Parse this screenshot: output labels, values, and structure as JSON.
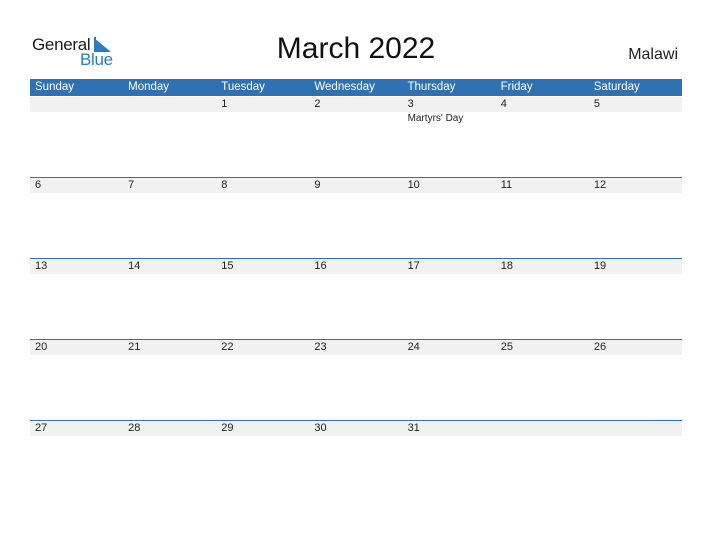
{
  "logo": {
    "line1": "General",
    "line2": "Blue",
    "accent": "#2a7bc4"
  },
  "title": "March 2022",
  "country": "Malawi",
  "colors": {
    "header_bg": "#2e72b3",
    "date_strip": "#f1f1f1"
  },
  "weekdays": [
    "Sunday",
    "Monday",
    "Tuesday",
    "Wednesday",
    "Thursday",
    "Friday",
    "Saturday"
  ],
  "weeks": [
    [
      {
        "day": ""
      },
      {
        "day": ""
      },
      {
        "day": "1"
      },
      {
        "day": "2"
      },
      {
        "day": "3",
        "holiday": "Martyrs' Day"
      },
      {
        "day": "4"
      },
      {
        "day": "5"
      }
    ],
    [
      {
        "day": "6"
      },
      {
        "day": "7"
      },
      {
        "day": "8"
      },
      {
        "day": "9"
      },
      {
        "day": "10"
      },
      {
        "day": "11"
      },
      {
        "day": "12"
      }
    ],
    [
      {
        "day": "13"
      },
      {
        "day": "14"
      },
      {
        "day": "15"
      },
      {
        "day": "16"
      },
      {
        "day": "17"
      },
      {
        "day": "18"
      },
      {
        "day": "19"
      }
    ],
    [
      {
        "day": "20"
      },
      {
        "day": "21"
      },
      {
        "day": "22"
      },
      {
        "day": "23"
      },
      {
        "day": "24"
      },
      {
        "day": "25"
      },
      {
        "day": "26"
      }
    ],
    [
      {
        "day": "27"
      },
      {
        "day": "28"
      },
      {
        "day": "29"
      },
      {
        "day": "30"
      },
      {
        "day": "31"
      },
      {
        "day": ""
      },
      {
        "day": ""
      }
    ]
  ]
}
